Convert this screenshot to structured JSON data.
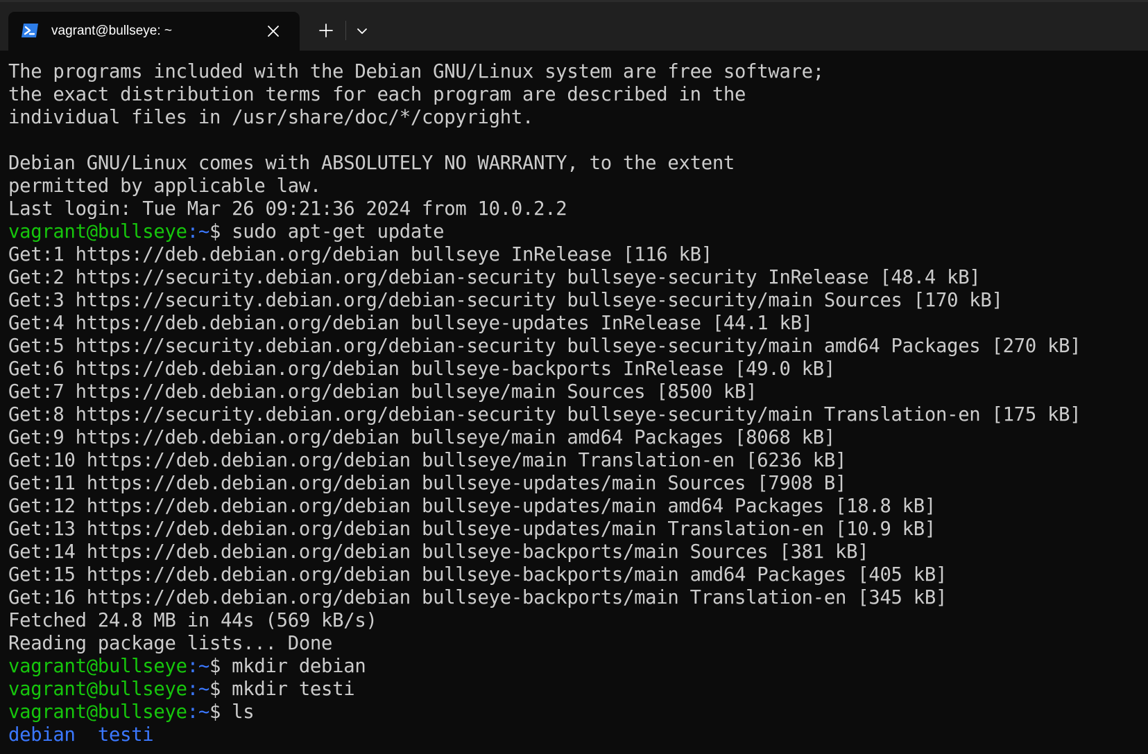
{
  "window": {
    "tab_title": "vagrant@bullseye: ~"
  },
  "icons": {
    "tab": "powershell-icon",
    "close": "close-icon",
    "new_tab": "plus-icon",
    "dropdown": "chevron-down-icon"
  },
  "colors": {
    "background": "#0c0c0c",
    "titlebar": "#202020",
    "text": "#cccccc",
    "prompt_user": "#16c60c",
    "prompt_path": "#3b78ff",
    "directory": "#3b78ff"
  },
  "prompt": {
    "user_host": "vagrant@bullseye",
    "path": ":~",
    "symbol": "$ "
  },
  "terminal": {
    "lines": [
      {
        "type": "text",
        "text": "The programs included with the Debian GNU/Linux system are free software;"
      },
      {
        "type": "text",
        "text": "the exact distribution terms for each program are described in the"
      },
      {
        "type": "text",
        "text": "individual files in /usr/share/doc/*/copyright."
      },
      {
        "type": "text",
        "text": ""
      },
      {
        "type": "text",
        "text": "Debian GNU/Linux comes with ABSOLUTELY NO WARRANTY, to the extent"
      },
      {
        "type": "text",
        "text": "permitted by applicable law."
      },
      {
        "type": "text",
        "text": "Last login: Tue Mar 26 09:21:36 2024 from 10.0.2.2"
      },
      {
        "type": "prompt",
        "command": "sudo apt-get update"
      },
      {
        "type": "text",
        "text": "Get:1 https://deb.debian.org/debian bullseye InRelease [116 kB]"
      },
      {
        "type": "text",
        "text": "Get:2 https://security.debian.org/debian-security bullseye-security InRelease [48.4 kB]"
      },
      {
        "type": "text",
        "text": "Get:3 https://security.debian.org/debian-security bullseye-security/main Sources [170 kB]"
      },
      {
        "type": "text",
        "text": "Get:4 https://deb.debian.org/debian bullseye-updates InRelease [44.1 kB]"
      },
      {
        "type": "text",
        "text": "Get:5 https://security.debian.org/debian-security bullseye-security/main amd64 Packages [270 kB]"
      },
      {
        "type": "text",
        "text": "Get:6 https://deb.debian.org/debian bullseye-backports InRelease [49.0 kB]"
      },
      {
        "type": "text",
        "text": "Get:7 https://deb.debian.org/debian bullseye/main Sources [8500 kB]"
      },
      {
        "type": "text",
        "text": "Get:8 https://security.debian.org/debian-security bullseye-security/main Translation-en [175 kB]"
      },
      {
        "type": "text",
        "text": "Get:9 https://deb.debian.org/debian bullseye/main amd64 Packages [8068 kB]"
      },
      {
        "type": "text",
        "text": "Get:10 https://deb.debian.org/debian bullseye/main Translation-en [6236 kB]"
      },
      {
        "type": "text",
        "text": "Get:11 https://deb.debian.org/debian bullseye-updates/main Sources [7908 B]"
      },
      {
        "type": "text",
        "text": "Get:12 https://deb.debian.org/debian bullseye-updates/main amd64 Packages [18.8 kB]"
      },
      {
        "type": "text",
        "text": "Get:13 https://deb.debian.org/debian bullseye-updates/main Translation-en [10.9 kB]"
      },
      {
        "type": "text",
        "text": "Get:14 https://deb.debian.org/debian bullseye-backports/main Sources [381 kB]"
      },
      {
        "type": "text",
        "text": "Get:15 https://deb.debian.org/debian bullseye-backports/main amd64 Packages [405 kB]"
      },
      {
        "type": "text",
        "text": "Get:16 https://deb.debian.org/debian bullseye-backports/main Translation-en [345 kB]"
      },
      {
        "type": "text",
        "text": "Fetched 24.8 MB in 44s (569 kB/s)"
      },
      {
        "type": "text",
        "text": "Reading package lists... Done"
      },
      {
        "type": "prompt",
        "command": "mkdir debian"
      },
      {
        "type": "prompt",
        "command": "mkdir testi"
      },
      {
        "type": "prompt",
        "command": "ls"
      },
      {
        "type": "dirs",
        "entries": [
          "debian",
          "testi"
        ]
      }
    ]
  }
}
